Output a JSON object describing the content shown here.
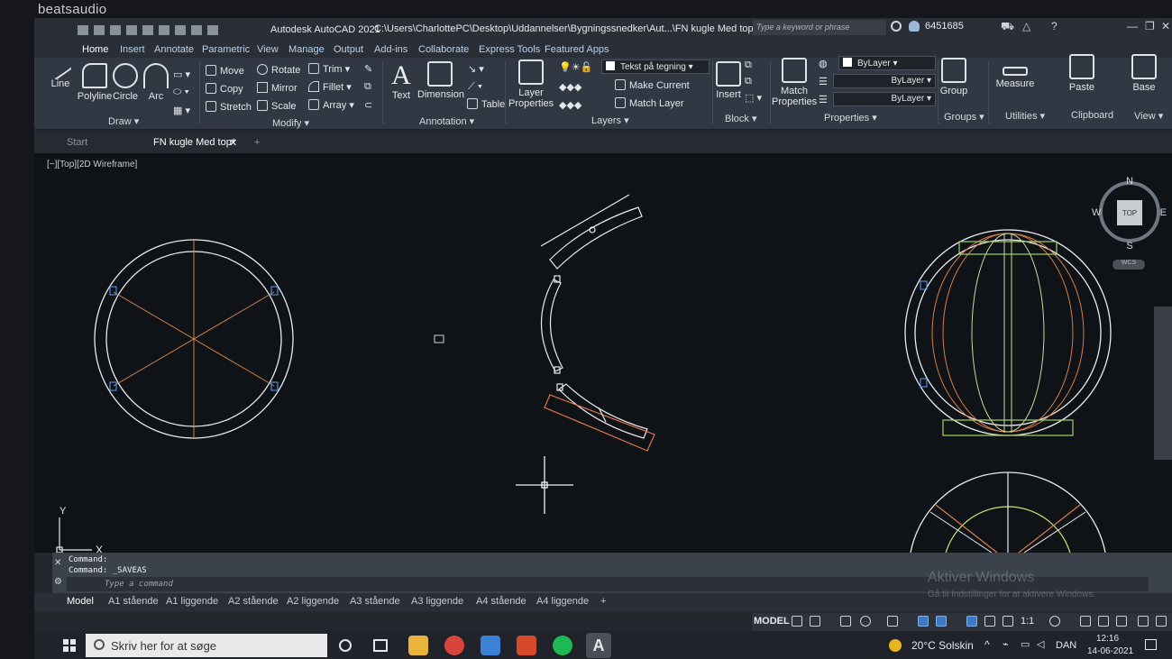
{
  "bezel": {
    "brand": "beatsaudio"
  },
  "titlebar": {
    "app_title": "Autodesk AutoCAD 2021",
    "file_path": "C:\\Users\\CharlottePC\\Desktop\\Uddannelser\\Bygningssnedker\\Aut...\\FN kugle Med top.dwg",
    "search_placeholder": "Type a keyword or phrase",
    "user_name": "6451685"
  },
  "ribbon_tabs": [
    "Home",
    "Insert",
    "Annotate",
    "Parametric",
    "View",
    "Manage",
    "Output",
    "Add-ins",
    "Collaborate",
    "Express Tools",
    "Featured Apps"
  ],
  "ribbon": {
    "draw": {
      "line": "Line",
      "polyline": "Polyline",
      "circle": "Circle",
      "arc": "Arc",
      "title": "Draw"
    },
    "modify": {
      "move": "Move",
      "rotate": "Rotate",
      "trim": "Trim",
      "copy": "Copy",
      "mirror": "Mirror",
      "fillet": "Fillet",
      "stretch": "Stretch",
      "scale": "Scale",
      "array": "Array",
      "title": "Modify"
    },
    "annotation": {
      "text": "Text",
      "dimension": "Dimension",
      "table": "Table",
      "title": "Annotation"
    },
    "layers": {
      "layer_properties_1": "Layer",
      "layer_properties_2": "Properties",
      "layer_combo": "Tekst på tegning",
      "make_current": "Make Current",
      "match_layer": "Match Layer",
      "title": "Layers"
    },
    "block": {
      "insert": "Insert",
      "title": "Block"
    },
    "properties": {
      "match_1": "Match",
      "match_2": "Properties",
      "color": "ByLayer",
      "linetype": "ByLayer",
      "lineweight": "ByLayer",
      "title": "Properties"
    },
    "groups": {
      "group": "Group",
      "title": "Groups"
    },
    "utilities": {
      "measure": "Measure",
      "title": "Utilities"
    },
    "clipboard": {
      "paste": "Paste",
      "title": "Clipboard"
    },
    "view": {
      "base": "Base",
      "title": "View"
    }
  },
  "doc_tabs": {
    "start": "Start",
    "file": "FN kugle Med top*"
  },
  "viewport": {
    "label": "[−][Top][2D Wireframe]",
    "viewcube": {
      "north": "N",
      "south": "S",
      "east": "E",
      "west": "W",
      "top": "TOP",
      "wcs": "WCS"
    },
    "ucs_x": "X",
    "ucs_y": "Y"
  },
  "command": {
    "line1": "Command:",
    "line2": "Command: _SAVEAS",
    "placeholder": "Type a command"
  },
  "layout_tabs": [
    "Model",
    "A1 stående",
    "A1 liggende",
    "A2 stående",
    "A2 liggende",
    "A3 stående",
    "A3 liggende",
    "A4 stående",
    "A4 liggende"
  ],
  "status": {
    "model": "MODEL",
    "scale": "1:1"
  },
  "watermark": {
    "title": "Aktiver Windows",
    "subtitle": "Gå til Indstillinger for at aktivere Windows."
  },
  "taskbar": {
    "search_placeholder": "Skriv her for at søge",
    "weather": "20°C Solskin",
    "language": "DAN",
    "time": "12:16",
    "date": "14-06-2021"
  }
}
